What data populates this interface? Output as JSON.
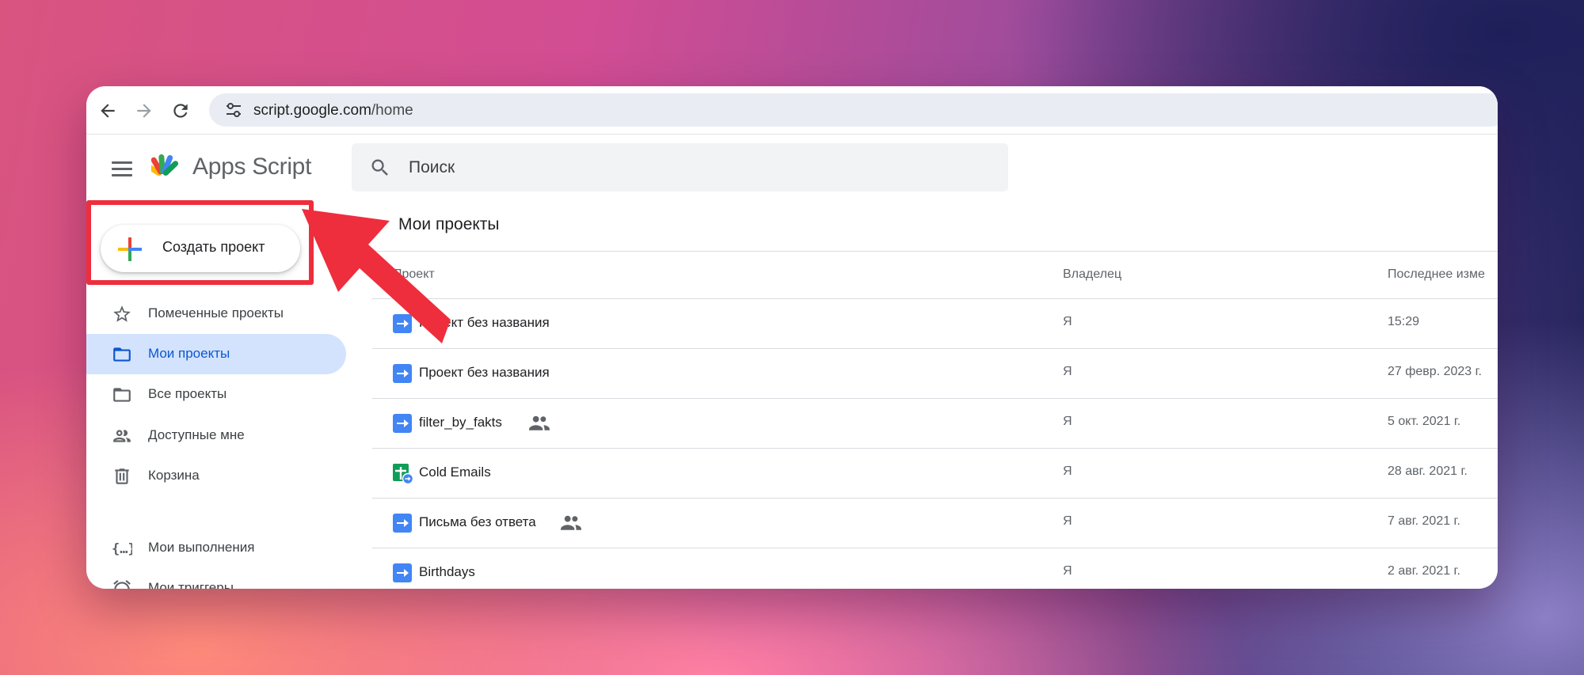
{
  "browser": {
    "url_host": "script.google.com",
    "url_path": "/home"
  },
  "app": {
    "title": "Apps Script",
    "search_placeholder": "Поиск"
  },
  "create_button": {
    "label": "Создать проект"
  },
  "sidebar": {
    "items": [
      {
        "label": "Помеченные проекты",
        "icon": "star-icon"
      },
      {
        "label": "Мои проекты",
        "icon": "folder-icon",
        "active": true
      },
      {
        "label": "Все проекты",
        "icon": "folder-icon"
      },
      {
        "label": "Доступные мне",
        "icon": "people-icon"
      },
      {
        "label": "Корзина",
        "icon": "trash-icon"
      },
      {
        "label": "Мои выполнения",
        "icon": "executions-icon"
      },
      {
        "label": "Мои триггеры",
        "icon": "alarm-icon"
      }
    ]
  },
  "main": {
    "section_title": "Мои проекты",
    "columns": {
      "project": "Проект",
      "owner": "Владелец",
      "modified": "Последнее изме"
    },
    "rows": [
      {
        "name": "Проект без названия",
        "owner": "Я",
        "modified": "15:29",
        "shared": false,
        "icon": "script-file-icon"
      },
      {
        "name": "Проект без названия",
        "owner": "Я",
        "modified": "27 февр. 2023 г.",
        "shared": false,
        "icon": "script-file-icon"
      },
      {
        "name": "filter_by_fakts",
        "owner": "Я",
        "modified": "5 окт. 2021 г.",
        "shared": true,
        "icon": "script-file-icon"
      },
      {
        "name": "Cold Emails",
        "owner": "Я",
        "modified": "28 авг. 2021 г.",
        "shared": false,
        "icon": "sheets-script-icon"
      },
      {
        "name": "Письма без ответа",
        "owner": "Я",
        "modified": "7 авг. 2021 г.",
        "shared": true,
        "icon": "script-file-icon"
      },
      {
        "name": "Birthdays",
        "owner": "Я",
        "modified": "2 авг. 2021 г.",
        "shared": false,
        "icon": "script-file-icon"
      }
    ]
  },
  "colors": {
    "accent_blue": "#4285f4",
    "active_bg": "#d3e3fd",
    "active_text": "#0b57d0",
    "highlight_red": "#ee2e3d"
  }
}
